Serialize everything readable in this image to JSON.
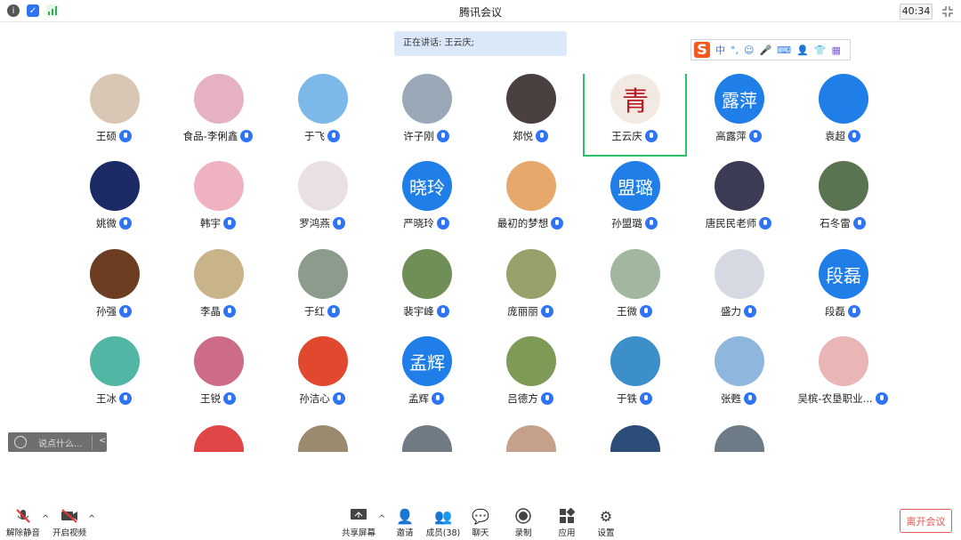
{
  "window": {
    "title": "腾讯会议",
    "timer": "40:34"
  },
  "speaking": "正在讲话: 王云庆;",
  "ime": {
    "lang": "中",
    "items": [
      "°,",
      "☺",
      "mic",
      "keyboard",
      "user",
      "shirt",
      "grid"
    ]
  },
  "participants": [
    {
      "name": "王硕",
      "av": "#d9c7b5"
    },
    {
      "name": "食品-李俐鑫",
      "av": "#e6b1c1"
    },
    {
      "name": "于飞",
      "av": "#7cb9e8"
    },
    {
      "name": "许子刚",
      "av": "#9aa8b8"
    },
    {
      "name": "郑悦",
      "av": "#4b4040"
    },
    {
      "name": "王云庆",
      "av": "#f3e9e3",
      "text": "青"
    },
    {
      "name": "高露萍",
      "av": "#1f7ee8",
      "text": "露萍"
    },
    {
      "name": "袁超",
      "av": "#1f7ee8"
    },
    {
      "name": "姚微",
      "av": "#1c2a66"
    },
    {
      "name": "韩宇",
      "av": "#efb2c0"
    },
    {
      "name": "罗鸿燕",
      "av": "#e9e1e1"
    },
    {
      "name": "严晓玲",
      "av": "#1f7ee8",
      "text": "晓玲"
    },
    {
      "name": "最初的梦想",
      "av": "#e7a86b"
    },
    {
      "name": "孙盟璐",
      "av": "#1f7ee8",
      "text": "盟璐"
    },
    {
      "name": "唐民民老师",
      "av": "#3b3b55"
    },
    {
      "name": "石冬雷",
      "av": "#5a7350"
    },
    {
      "name": "孙强",
      "av": "#6d3d22"
    },
    {
      "name": "李晶",
      "av": "#c9b48a"
    },
    {
      "name": "于红",
      "av": "#8c9b8c"
    },
    {
      "name": "裴宇峰",
      "av": "#6f8f56"
    },
    {
      "name": "庞丽丽",
      "av": "#99a06a"
    },
    {
      "name": "王微",
      "av": "#a1b7a0"
    },
    {
      "name": "盛力",
      "av": "#d6d9e2"
    },
    {
      "name": "段磊",
      "av": "#1f7ee8",
      "text": "段磊"
    },
    {
      "name": "王冰",
      "av": "#52b6a5"
    },
    {
      "name": "王锐",
      "av": "#cc6c88"
    },
    {
      "name": "孙洁心",
      "av": "#e0492d"
    },
    {
      "name": "孟辉",
      "av": "#1f7ee8",
      "text": "孟辉"
    },
    {
      "name": "吕德方",
      "av": "#7e9a57"
    },
    {
      "name": "于铁",
      "av": "#3c8fc9"
    },
    {
      "name": "张甦",
      "av": "#8fb7de"
    },
    {
      "name": "吴槟-农垦职业...",
      "av": "#e9b5b5"
    }
  ],
  "partial_avatars": [
    "#e04646",
    "#9b8a6d",
    "#707a84",
    "#c5a18b",
    "#2b4d78",
    "#6c7b86"
  ],
  "chat": {
    "placeholder": "说点什么...",
    "arrow": "<"
  },
  "toolbar": {
    "mute": "解除静音",
    "video": "开启视频",
    "share": "共享屏幕",
    "invite": "邀请",
    "members": "成员(38)",
    "chat": "聊天",
    "record": "录制",
    "apps": "应用",
    "settings": "设置",
    "leave": "离开会议"
  }
}
